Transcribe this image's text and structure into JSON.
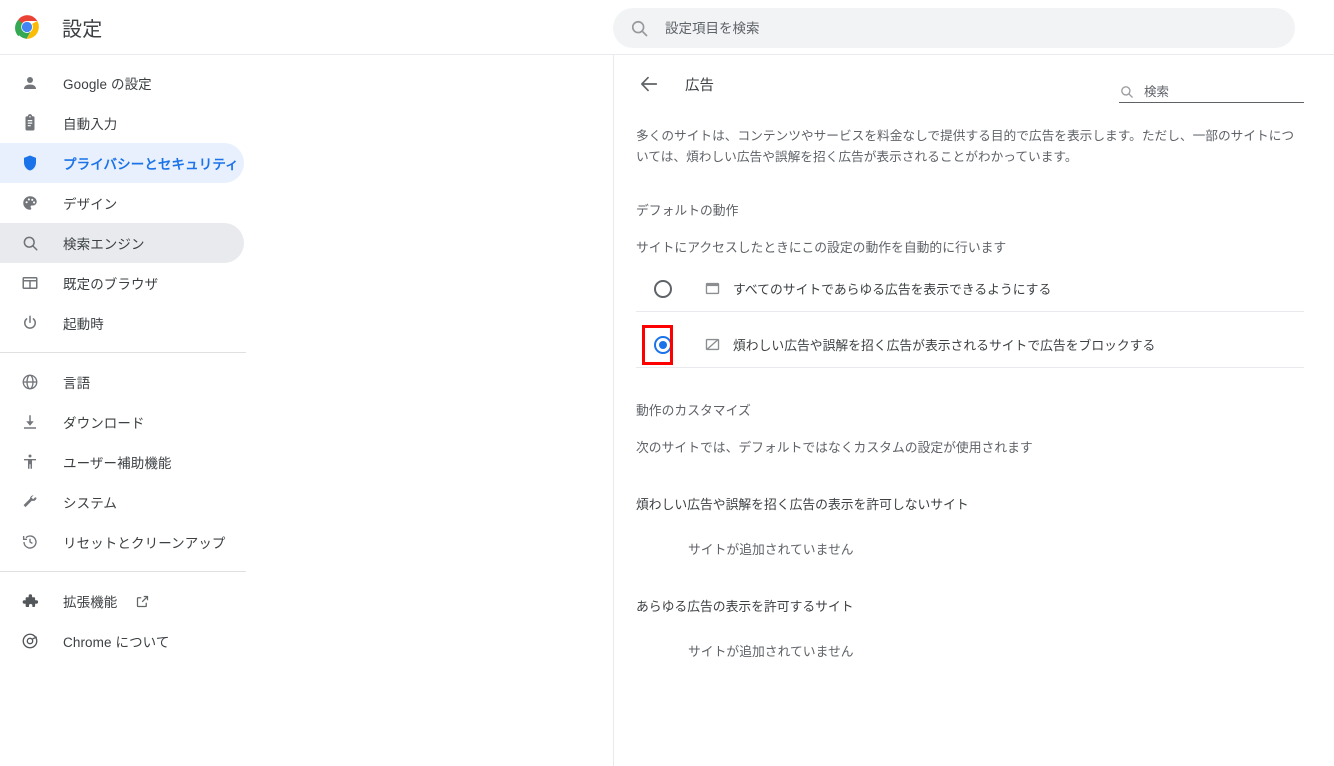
{
  "app": {
    "title": "設定",
    "logo_icon": "chrome-logo-icon"
  },
  "search": {
    "icon": "search-icon",
    "placeholder": "設定項目を検索",
    "value": ""
  },
  "sidebar": {
    "groups": [
      {
        "items": [
          {
            "icon": "person-icon",
            "label": "Google の設定",
            "state": "normal"
          },
          {
            "icon": "autofill-icon",
            "label": "自動入力",
            "state": "normal"
          },
          {
            "icon": "shield-icon",
            "label": "プライバシーとセキュリティ",
            "state": "selected"
          },
          {
            "icon": "palette-icon",
            "label": "デザイン",
            "state": "normal"
          },
          {
            "icon": "search-icon",
            "label": "検索エンジン",
            "state": "hovered"
          },
          {
            "icon": "browser-icon",
            "label": "既定のブラウザ",
            "state": "normal"
          },
          {
            "icon": "power-icon",
            "label": "起動時",
            "state": "normal"
          }
        ]
      },
      {
        "items": [
          {
            "icon": "globe-icon",
            "label": "言語",
            "state": "normal"
          },
          {
            "icon": "download-icon",
            "label": "ダウンロード",
            "state": "normal"
          },
          {
            "icon": "accessibility-icon",
            "label": "ユーザー補助機能",
            "state": "normal"
          },
          {
            "icon": "wrench-icon",
            "label": "システム",
            "state": "normal"
          },
          {
            "icon": "restore-icon",
            "label": "リセットとクリーンアップ",
            "state": "normal"
          }
        ]
      },
      {
        "items": [
          {
            "icon": "puzzle-icon",
            "label": "拡張機能",
            "state": "normal",
            "external": true,
            "external_icon": "open-in-new-icon"
          },
          {
            "icon": "chrome-outline-icon",
            "label": "Chrome について",
            "state": "normal"
          }
        ]
      }
    ]
  },
  "main": {
    "back_icon": "arrow-back-icon",
    "title": "広告",
    "page_search": {
      "icon": "search-icon",
      "placeholder": "検索",
      "value": ""
    },
    "description": "多くのサイトは、コンテンツやサービスを料金なしで提供する目的で広告を表示します。ただし、一部のサイトについては、煩わしい広告や誤解を招く広告が表示されることがわかっています。",
    "default_behavior": {
      "title": "デフォルトの動作",
      "subtitle": "サイトにアクセスしたときにこの設定の動作を自動的に行います",
      "options": [
        {
          "icon": "window-ad-icon",
          "label": "すべてのサイトであらゆる広告を表示できるようにする",
          "selected": false,
          "highlighted": false
        },
        {
          "icon": "window-ad-blocked-icon",
          "label": "煩わしい広告や誤解を招く広告が表示されるサイトで広告をブロックする",
          "selected": true,
          "highlighted": true
        }
      ]
    },
    "customized_behavior": {
      "title": "動作のカスタマイズ",
      "subtitle": "次のサイトでは、デフォルトではなくカスタムの設定が使用されます",
      "lists": [
        {
          "label": "煩わしい広告や誤解を招く広告の表示を許可しないサイト",
          "empty": "サイトが追加されていません"
        },
        {
          "label": "あらゆる広告の表示を許可するサイト",
          "empty": "サイトが追加されていません"
        }
      ]
    }
  },
  "colors": {
    "accent": "#1a73e8",
    "accent_bg": "#e8f0fe",
    "hover_bg": "#e8eaed",
    "text": "#3c4043",
    "secondary_text": "#5f6368",
    "highlight_box": "#ff0000"
  }
}
